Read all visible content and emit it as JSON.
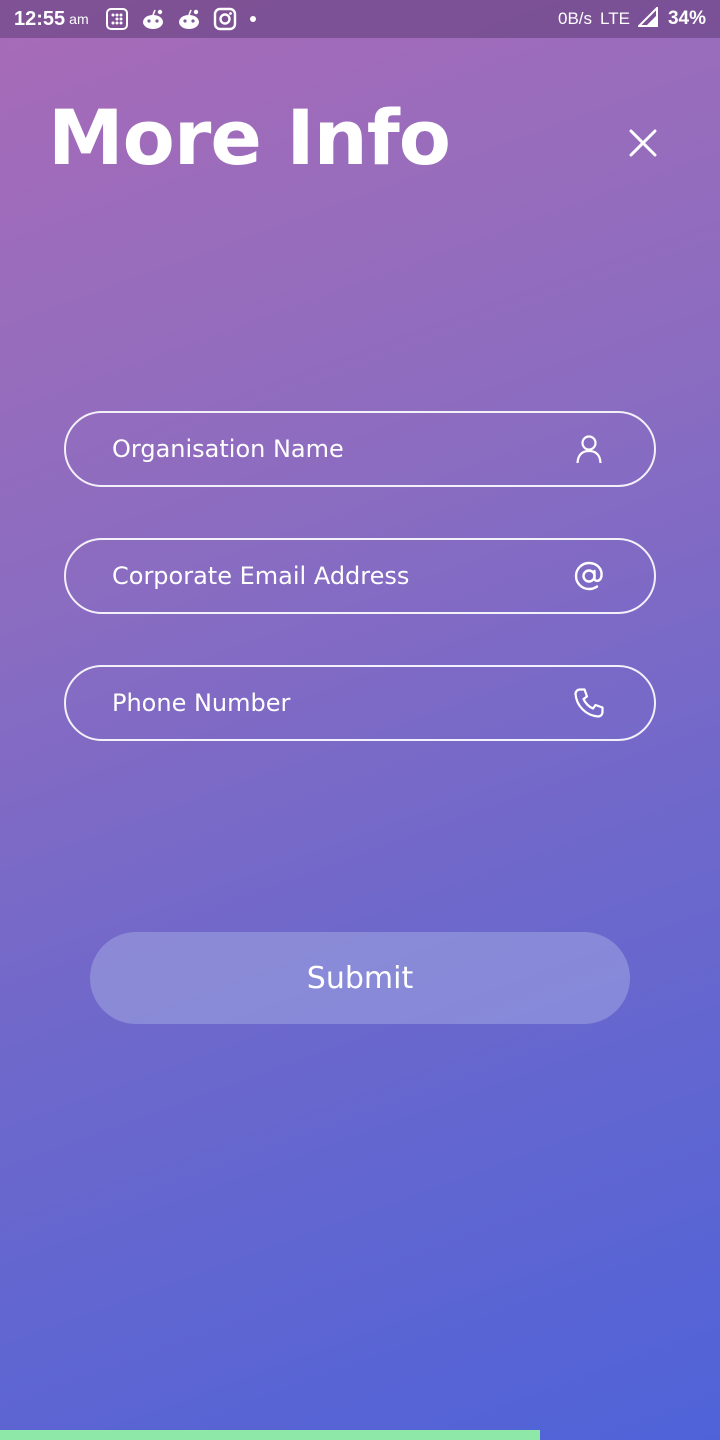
{
  "status_bar": {
    "time": "12:55",
    "ampm": "am",
    "net_speed": "0B/s",
    "network_type": "LTE",
    "battery": "34%",
    "notification_icons": [
      "app-grid-icon",
      "reddit-icon",
      "reddit-icon",
      "instagram-icon",
      "dot-icon"
    ]
  },
  "page": {
    "title": "More Info",
    "close_icon": "close-icon"
  },
  "form": {
    "organisation": {
      "placeholder": "Organisation Name",
      "value": "",
      "icon": "user-icon"
    },
    "email": {
      "placeholder": "Corporate Email Address",
      "value": "",
      "icon": "at-icon"
    },
    "phone": {
      "placeholder": "Phone Number",
      "value": "",
      "icon": "phone-icon"
    },
    "submit_label": "Submit"
  },
  "progress": {
    "fraction": 0.75,
    "color": "#8ee8a8"
  },
  "colors": {
    "gradient_top": "#a86bb8",
    "gradient_bottom": "#4f63d8",
    "text": "#ffffff"
  }
}
